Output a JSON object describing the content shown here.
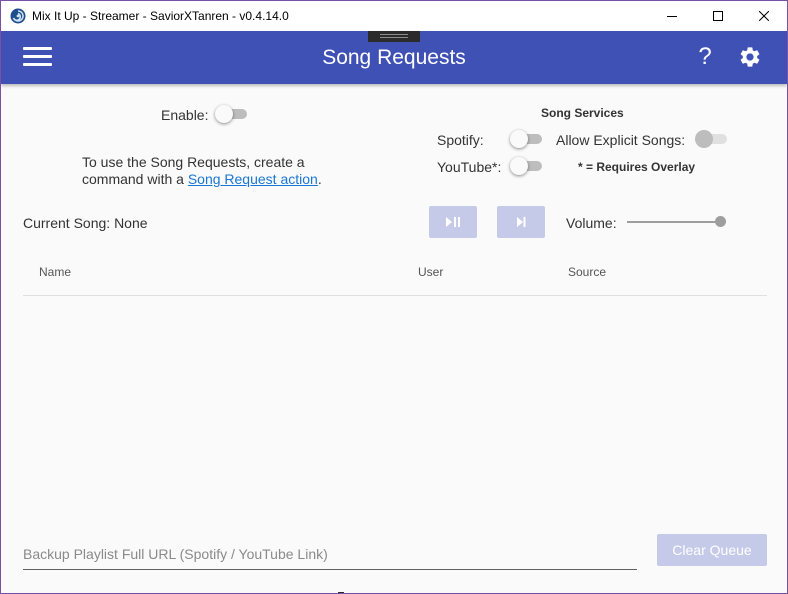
{
  "window": {
    "title": "Mix It Up - Streamer - SaviorXTanren - v0.4.14.0"
  },
  "header": {
    "title": "Song Requests",
    "help_label": "?",
    "accent_color": "#3f51b5"
  },
  "settings": {
    "enable_label": "Enable:",
    "enable_on": false,
    "instructions_prefix": "To use the Song Requests, create a",
    "instructions_line2": "command with a ",
    "instructions_link": "Song Request action",
    "instructions_suffix": "."
  },
  "services": {
    "heading": "Song Services",
    "spotify_label": "Spotify:",
    "spotify_on": false,
    "youtube_label": "YouTube*:",
    "youtube_on": false,
    "explicit_label": "Allow Explicit Songs:",
    "explicit_on": false,
    "overlay_note": "* = Requires Overlay"
  },
  "playback": {
    "current_song_label": "Current Song:",
    "current_song_value": "None",
    "volume_label": "Volume:",
    "volume_level": 100,
    "play_pause_icon": "play-pause-icon",
    "skip_icon": "skip-next-icon"
  },
  "queue": {
    "columns": [
      "Name",
      "User",
      "Source"
    ],
    "rows": []
  },
  "footer": {
    "backup_placeholder": "Backup Playlist Full URL (Spotify / YouTube Link)",
    "backup_value": "",
    "clear_label": "Clear Queue"
  }
}
